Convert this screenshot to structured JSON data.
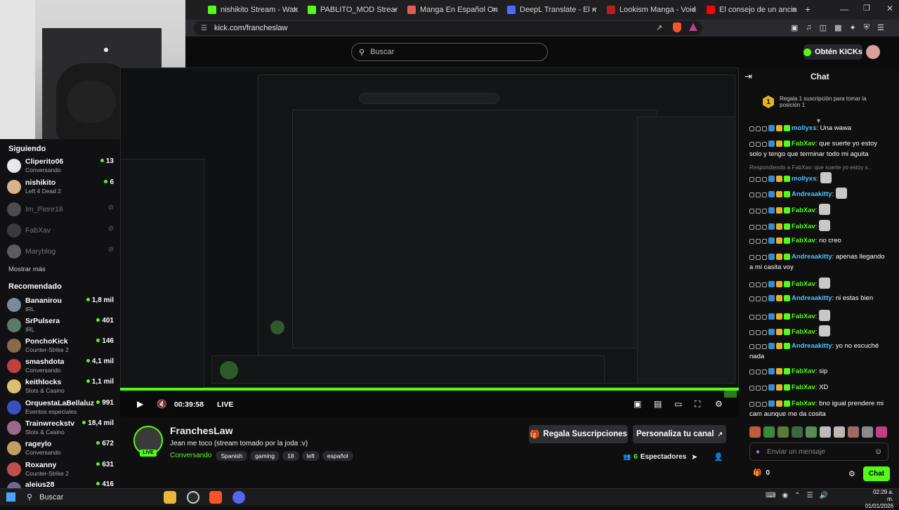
{
  "browser": {
    "tabs": [
      {
        "label": "nishikito Stream - Watch Live o",
        "color": "#53fc18"
      },
      {
        "label": "PABLITO_MOD Stream - Watch",
        "color": "#53fc18"
      },
      {
        "label": "Manga En Español Online Grat",
        "color": "#e05a5a"
      },
      {
        "label": "DeepL Translate - El mejor trad",
        "color": "#4f6bff"
      },
      {
        "label": "Lookism Manga - Void Scans ll",
        "color": "#b82020"
      },
      {
        "label": "El consejo de un anciano. - You",
        "color": "#ff0000"
      }
    ],
    "url": "kick.com/francheslaw",
    "add_tab": "+"
  },
  "header": {
    "search_placeholder": "Buscar",
    "kicks_label": "Obtén KICKs"
  },
  "sidebar": {
    "following_title": "Siguiendo",
    "following": [
      {
        "name": "Cliperito06",
        "sub": "Conversando",
        "count": "13",
        "live": true,
        "color": "#e8e8e8"
      },
      {
        "name": "nishikito",
        "sub": "Left 4 Dead 2",
        "count": "6",
        "live": true,
        "color": "#d9b38c"
      },
      {
        "name": "Im_Piere18",
        "sub": "",
        "count": "",
        "live": false,
        "color": "#888"
      },
      {
        "name": "FabXav",
        "sub": "",
        "count": "",
        "live": false,
        "color": "#666"
      },
      {
        "name": "Maryblog",
        "sub": "",
        "count": "",
        "live": false,
        "color": "#aaa"
      }
    ],
    "show_more": "Mostrar más",
    "recommended_title": "Recomendado",
    "recommended": [
      {
        "name": "Bananirou",
        "sub": "IRL",
        "count": "1,8 mil",
        "color": "#7a8a9a"
      },
      {
        "name": "SrPulsera",
        "sub": "IRL",
        "count": "401",
        "color": "#5b7a6a"
      },
      {
        "name": "PonchoKick",
        "sub": "Counter-Strike 2",
        "count": "146",
        "color": "#8a6a4a"
      },
      {
        "name": "smashdota",
        "sub": "Conversando",
        "count": "4,1 mil",
        "color": "#c04040"
      },
      {
        "name": "keithlocks",
        "sub": "Slots & Casino",
        "count": "1,1 mil",
        "color": "#d8c070"
      },
      {
        "name": "OrquestaLaBellaluz",
        "sub": "Eventos especiales",
        "count": "991",
        "color": "#3a50c0"
      },
      {
        "name": "Trainwreckstv",
        "sub": "Slots & Casino",
        "count": "18,4 mil",
        "color": "#9a6a8a"
      },
      {
        "name": "rageylo",
        "sub": "Conversando",
        "count": "672",
        "color": "#c0a060"
      },
      {
        "name": "Roxanny",
        "sub": "Counter-Strike 2",
        "count": "631",
        "color": "#c05050"
      },
      {
        "name": "aleius28",
        "sub": "",
        "count": "416",
        "color": "#6a6a9a"
      }
    ]
  },
  "player": {
    "time": "00:39:58",
    "live_label": "LIVE"
  },
  "channel": {
    "name": "FranchesLaw",
    "title": "Jean me toco (stream tomado por la joda :v)",
    "category": "Conversando",
    "tags": [
      "Spanish",
      "gaming",
      "18",
      "left",
      "español"
    ],
    "live_badge": "LIVE",
    "viewers": "6",
    "viewers_label": "Espectadores",
    "gift_button": "Regala Suscripciones",
    "customize_button": "Personaliza tu canal"
  },
  "chat": {
    "title": "Chat",
    "pinned_text": "Regala 1 suscripción para tomar la posición 1",
    "pinned_rank": "1",
    "reply_hint": "Respondiendo a FabXav: que suerte yo estoy s...",
    "messages": [
      {
        "user": "mollyxs",
        "text": "Una wawa",
        "cls": "un-mol",
        "emote": false
      },
      {
        "user": "FabXav",
        "text": "que suerte yo estoy solo y tengo que terminar todo mi aguita",
        "cls": "un-fab",
        "emote": false
      },
      {
        "user": "mollyxs",
        "text": "",
        "cls": "un-mol",
        "emote": true
      },
      {
        "user": "Andreaakitty",
        "text": "",
        "cls": "un-and",
        "emote": true
      },
      {
        "user": "FabXav",
        "text": "",
        "cls": "un-fab",
        "emote": true
      },
      {
        "user": "FabXav",
        "text": "",
        "cls": "un-fab",
        "emote": true
      },
      {
        "user": "FabXav",
        "text": "no creo",
        "cls": "un-fab",
        "emote": false
      },
      {
        "user": "Andreaakitty",
        "text": "apenas llegando a mi casita voy",
        "cls": "un-and",
        "emote": false
      },
      {
        "user": "FabXav",
        "text": "",
        "cls": "un-fab",
        "emote": true
      },
      {
        "user": "Andreaakitty",
        "text": "ni estas bien",
        "cls": "un-and",
        "emote": false
      },
      {
        "user": "FabXav",
        "text": "",
        "cls": "un-fab",
        "emote": true
      },
      {
        "user": "FabXav",
        "text": "",
        "cls": "un-fab",
        "emote": true
      },
      {
        "user": "Andreaakitty",
        "text": "yo no escuché nada",
        "cls": "un-and",
        "emote": false
      },
      {
        "user": "FabXav",
        "text": "sip",
        "cls": "un-fab",
        "emote": false
      },
      {
        "user": "FabXav",
        "text": "XD",
        "cls": "un-fab",
        "emote": false
      },
      {
        "user": "FabXav",
        "text": "bno igual prendere mi cam aunque me da cosita",
        "cls": "un-fab",
        "emote": false
      }
    ],
    "input_placeholder": "Enviar un mensaje",
    "points": "0",
    "send_label": "Chat"
  },
  "taskbar": {
    "search_label": "Buscar",
    "time": "02:29 a. m.",
    "date": "01/01/2026"
  }
}
